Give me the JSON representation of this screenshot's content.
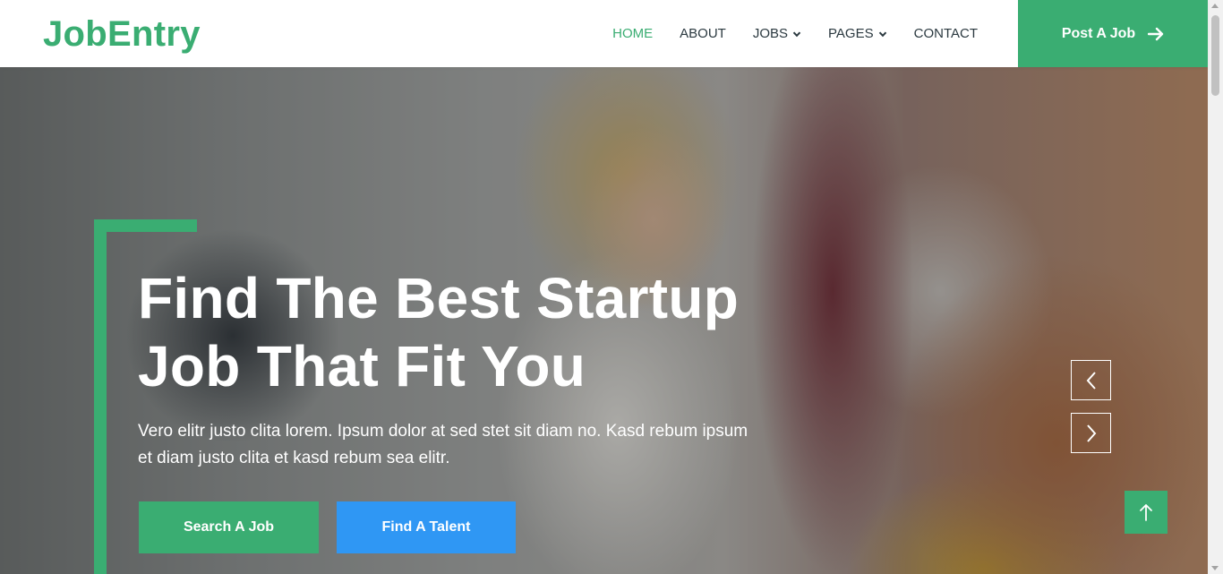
{
  "brand": {
    "name": "JobEntry"
  },
  "nav": {
    "items": [
      {
        "label": "HOME",
        "active": true
      },
      {
        "label": "ABOUT",
        "active": false
      },
      {
        "label": "JOBS",
        "dropdown": true
      },
      {
        "label": "PAGES",
        "dropdown": true
      },
      {
        "label": "CONTACT",
        "active": false
      }
    ],
    "cta_label": "Post A Job"
  },
  "hero": {
    "title_line1": "Find The Best Startup",
    "title_line2": "Job That Fit You",
    "text": "Vero elitr justo clita lorem. Ipsum dolor at sed stet sit diam no. Kasd rebum ipsum et diam justo clita et kasd rebum sea elitr.",
    "buttons": {
      "search": "Search A Job",
      "talent": "Find A Talent"
    }
  },
  "colors": {
    "primary": "#3aad72",
    "secondary": "#2f97f4",
    "dark": "#2b3940"
  },
  "icons": {
    "cta": "arrow-right-icon",
    "prev": "chevron-left-icon",
    "next": "chevron-right-icon",
    "back_to_top": "arrow-up-icon",
    "dropdown": "chevron-down-icon"
  }
}
